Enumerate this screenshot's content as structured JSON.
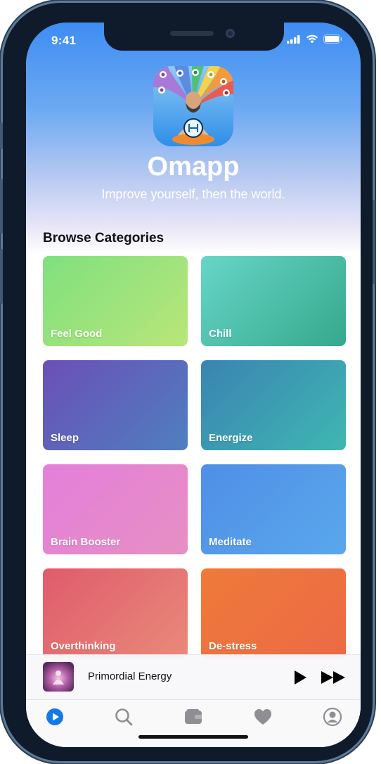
{
  "status": {
    "time": "9:41"
  },
  "app": {
    "name": "Omapp",
    "tagline": "Improve yourself, then the world."
  },
  "section": {
    "title": "Browse Categories"
  },
  "categories": [
    {
      "label": "Feel Good",
      "from": "#7fe07e",
      "to": "#b9e67a"
    },
    {
      "label": "Chill",
      "from": "#67d6c7",
      "to": "#35a88c"
    },
    {
      "label": "Sleep",
      "from": "#6b4fb6",
      "to": "#4f7fc0"
    },
    {
      "label": "Energize",
      "from": "#3a84b2",
      "to": "#3fb7b2"
    },
    {
      "label": "Brain Booster",
      "from": "#e47fdc",
      "to": "#e78fc2"
    },
    {
      "label": "Meditate",
      "from": "#4f8fe6",
      "to": "#5aa7ec"
    },
    {
      "label": "Overthinking",
      "from": "#e05b6c",
      "to": "#e98a7a"
    },
    {
      "label": "De-stress",
      "from": "#ee7a3a",
      "to": "#ec6a45"
    }
  ],
  "player": {
    "track": "Primordial Energy"
  },
  "tabs": [
    {
      "name": "play-icon",
      "active": true
    },
    {
      "name": "search-icon",
      "active": false
    },
    {
      "name": "wallet-icon",
      "active": false
    },
    {
      "name": "heart-icon",
      "active": false
    },
    {
      "name": "profile-icon",
      "active": false
    }
  ],
  "colors": {
    "accent": "#1478e6",
    "inactive": "#8e8e93"
  }
}
